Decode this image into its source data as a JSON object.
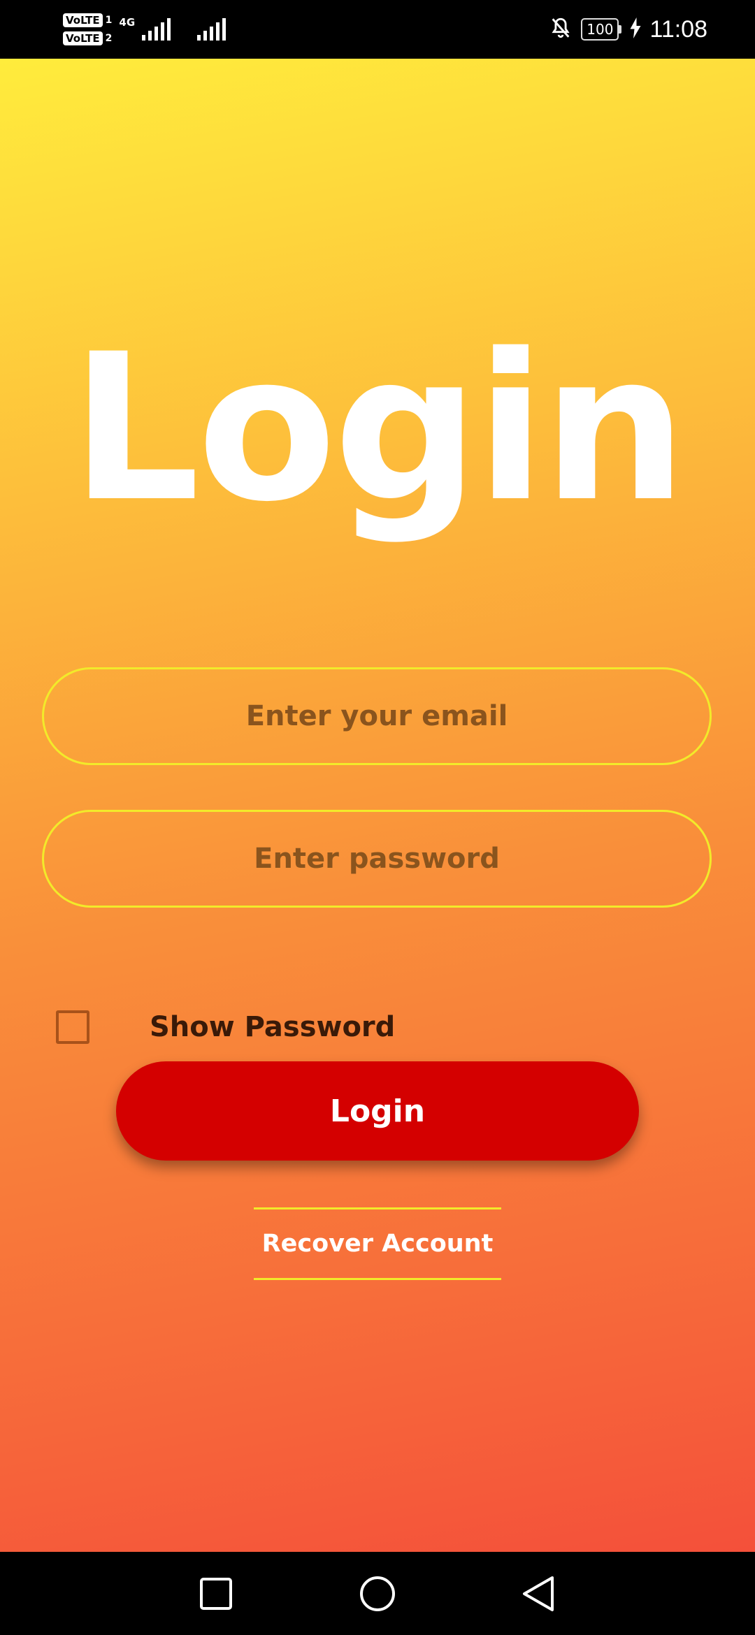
{
  "status_bar": {
    "sim1_label": "VoLTE",
    "sim1_num": "1",
    "sim2_label": "VoLTE",
    "sim2_num": "2",
    "network": "4G",
    "battery": "100",
    "time": "11:08"
  },
  "login": {
    "title": "Login",
    "email_placeholder": "Enter your email",
    "password_placeholder": "Enter password",
    "show_password_label": "Show Password",
    "show_password_checked": false,
    "login_button": "Login",
    "recover_link": "Recover Account"
  },
  "icons": {
    "status": [
      "signal-icon",
      "mute-notification-icon",
      "battery-icon",
      "charging-icon"
    ],
    "nav": [
      "recent-apps-icon",
      "home-icon",
      "back-icon"
    ]
  },
  "colors": {
    "gradient_top": "#ffec3c",
    "gradient_bottom": "#f4503a",
    "field_border": "#f2ea2a",
    "login_button": "#d40000",
    "placeholder_text": "#8a541d"
  }
}
